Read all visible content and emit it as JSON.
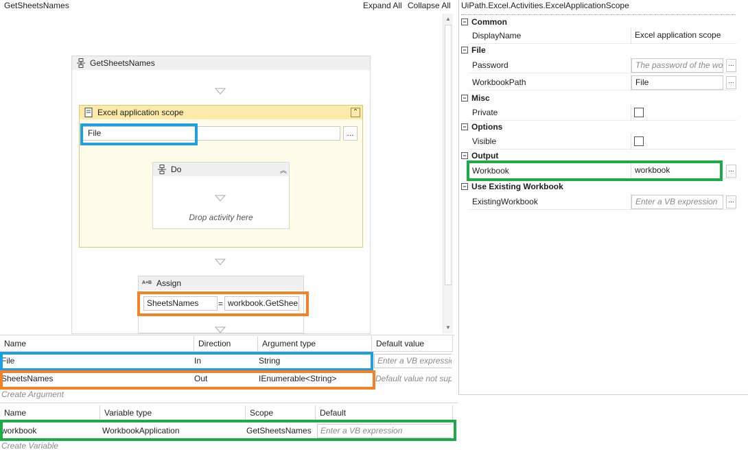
{
  "designer": {
    "title": "GetSheetsNames",
    "expand_all": "Expand All",
    "collapse_all": "Collapse All",
    "sequence": {
      "title": "GetSheetsNames"
    },
    "scope": {
      "title": "Excel application scope",
      "path_value": "File",
      "browse_label": "..."
    },
    "do_block": {
      "title": "Do",
      "drop_hint": "Drop activity here"
    },
    "assign": {
      "title": "Assign",
      "icon_text": "A+B",
      "to_value": "SheetsNames",
      "eq": "=",
      "value": "workbook.GetShee"
    }
  },
  "arguments": {
    "headers": [
      "Name",
      "Direction",
      "Argument type",
      "Default value"
    ],
    "rows": [
      {
        "name": "File",
        "direction": "In",
        "type": "String",
        "default": "Enter a VB expressic"
      },
      {
        "name": "SheetsNames",
        "direction": "Out",
        "type": "IEnumerable<String>",
        "default": "Default value not sup"
      }
    ],
    "create_label": "Create Argument"
  },
  "variables": {
    "headers": [
      "Name",
      "Variable type",
      "Scope",
      "Default"
    ],
    "rows": [
      {
        "name": "workbook",
        "type": "WorkbookApplication",
        "scope": "GetSheetsNames",
        "default": "Enter a VB expression"
      }
    ],
    "create_label": "Create Variable"
  },
  "properties": {
    "title": "UiPath.Excel.Activities.ExcelApplicationScope",
    "categories": {
      "common": "Common",
      "file": "File",
      "misc": "Misc",
      "options": "Options",
      "output": "Output",
      "existing": "Use Existing Workbook"
    },
    "display_name": {
      "label": "DisplayName",
      "value": "Excel application scope"
    },
    "password": {
      "label": "Password",
      "placeholder": "The password of the wor"
    },
    "workbook_path": {
      "label": "WorkbookPath",
      "value": "File"
    },
    "private": {
      "label": "Private",
      "checked": false
    },
    "visible": {
      "label": "Visible",
      "checked": false
    },
    "workbook": {
      "label": "Workbook",
      "value": "workbook"
    },
    "existing_workbook": {
      "label": "ExistingWorkbook",
      "placeholder": "Enter a VB expression"
    },
    "collapse_glyph": "⊟",
    "browse_label": "..."
  },
  "colors": {
    "highlight_blue": "#1ba1e2",
    "highlight_orange": "#f58025",
    "highlight_green": "#1cac47",
    "scope_bg": "#fffbe9"
  }
}
